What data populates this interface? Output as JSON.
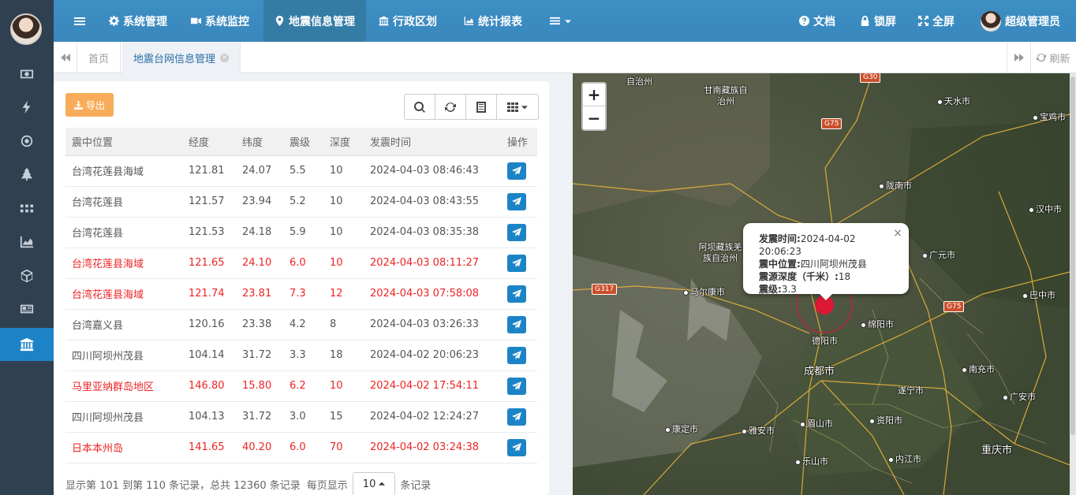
{
  "nav": {
    "items": [
      {
        "label": "系统管理",
        "icon": "gear-icon"
      },
      {
        "label": "系统监控",
        "icon": "video-icon"
      },
      {
        "label": "地震信息管理",
        "icon": "map-marker-icon"
      },
      {
        "label": "行政区划",
        "icon": "bank-icon"
      },
      {
        "label": "统计报表",
        "icon": "area-chart-icon"
      }
    ],
    "right": {
      "docs": "文档",
      "lock": "锁屏",
      "fullscreen": "全屏",
      "user": "超级管理员"
    }
  },
  "sidebar": {
    "icons": [
      "money-icon",
      "bolt-icon",
      "dot-circle-icon",
      "tree-icon",
      "grid-icon",
      "chart-icon",
      "cube-icon",
      "newspaper-icon",
      "bank-icon"
    ]
  },
  "tabs": {
    "home": "首页",
    "current": "地震台网信息管理",
    "refresh": "刷新"
  },
  "toolbar": {
    "export": "导出"
  },
  "table": {
    "headers": [
      "震中位置",
      "经度",
      "纬度",
      "震级",
      "深度",
      "发震时间",
      "操作"
    ],
    "rows": [
      {
        "place": "台湾花莲县海域",
        "lon": "121.81",
        "lat": "24.07",
        "mag": "5.5",
        "depth": "10",
        "time": "2024-04-03 08:46:43",
        "red": false
      },
      {
        "place": "台湾花莲县",
        "lon": "121.57",
        "lat": "23.94",
        "mag": "5.2",
        "depth": "10",
        "time": "2024-04-03 08:43:55",
        "red": false
      },
      {
        "place": "台湾花莲县",
        "lon": "121.53",
        "lat": "24.18",
        "mag": "5.9",
        "depth": "10",
        "time": "2024-04-03 08:35:38",
        "red": false
      },
      {
        "place": "台湾花莲县海域",
        "lon": "121.65",
        "lat": "24.10",
        "mag": "6.0",
        "depth": "10",
        "time": "2024-04-03 08:11:27",
        "red": true
      },
      {
        "place": "台湾花莲县海域",
        "lon": "121.74",
        "lat": "23.81",
        "mag": "7.3",
        "depth": "12",
        "time": "2024-04-03 07:58:08",
        "red": true
      },
      {
        "place": "台湾嘉义县",
        "lon": "120.16",
        "lat": "23.38",
        "mag": "4.2",
        "depth": "8",
        "time": "2024-04-03 03:26:33",
        "red": false
      },
      {
        "place": "四川阿坝州茂县",
        "lon": "104.14",
        "lat": "31.72",
        "mag": "3.3",
        "depth": "18",
        "time": "2024-04-02 20:06:23",
        "red": false
      },
      {
        "place": "马里亚纳群岛地区",
        "lon": "146.80",
        "lat": "15.80",
        "mag": "6.2",
        "depth": "10",
        "time": "2024-04-02 17:54:11",
        "red": true
      },
      {
        "place": "四川阿坝州茂县",
        "lon": "104.13",
        "lat": "31.72",
        "mag": "3.0",
        "depth": "15",
        "time": "2024-04-02 12:24:27",
        "red": false
      },
      {
        "place": "日本本州岛",
        "lon": "141.65",
        "lat": "40.20",
        "mag": "6.0",
        "depth": "70",
        "time": "2024-04-02 03:24:38",
        "red": true
      }
    ]
  },
  "pagination": {
    "summary": "显示第 101 到第 110 条记录，总共 12360 条记录",
    "per_page_prefix": "每页显示",
    "per_page": "10",
    "per_page_suffix": "条记录"
  },
  "popup": {
    "time_label": "发震时间:",
    "time": "2024-04-02 20:06:23",
    "place_label": "震中位置:",
    "place": "四川阿坝州茂县",
    "depth_label": "震源深度（千米）:",
    "depth": "18",
    "mag_label": "震级:",
    "mag": "3.3"
  },
  "map": {
    "zoom_in": "+",
    "zoom_out": "−",
    "labels": [
      "自治州",
      "甘南藏族自治州",
      "天水市",
      "宝鸡市",
      "陇南市",
      "汉中市",
      "阿坝藏族羌族自治州",
      "广元市",
      "马尔康市",
      "巴中市",
      "绵阳市",
      "德阳市",
      "成都市",
      "南充市",
      "遂宁市",
      "广安市",
      "康定市",
      "雅安市",
      "眉山市",
      "资阳市",
      "乐山市",
      "内江市",
      "重庆市"
    ],
    "roads": [
      "G30",
      "G75",
      "G317",
      "G75"
    ]
  }
}
